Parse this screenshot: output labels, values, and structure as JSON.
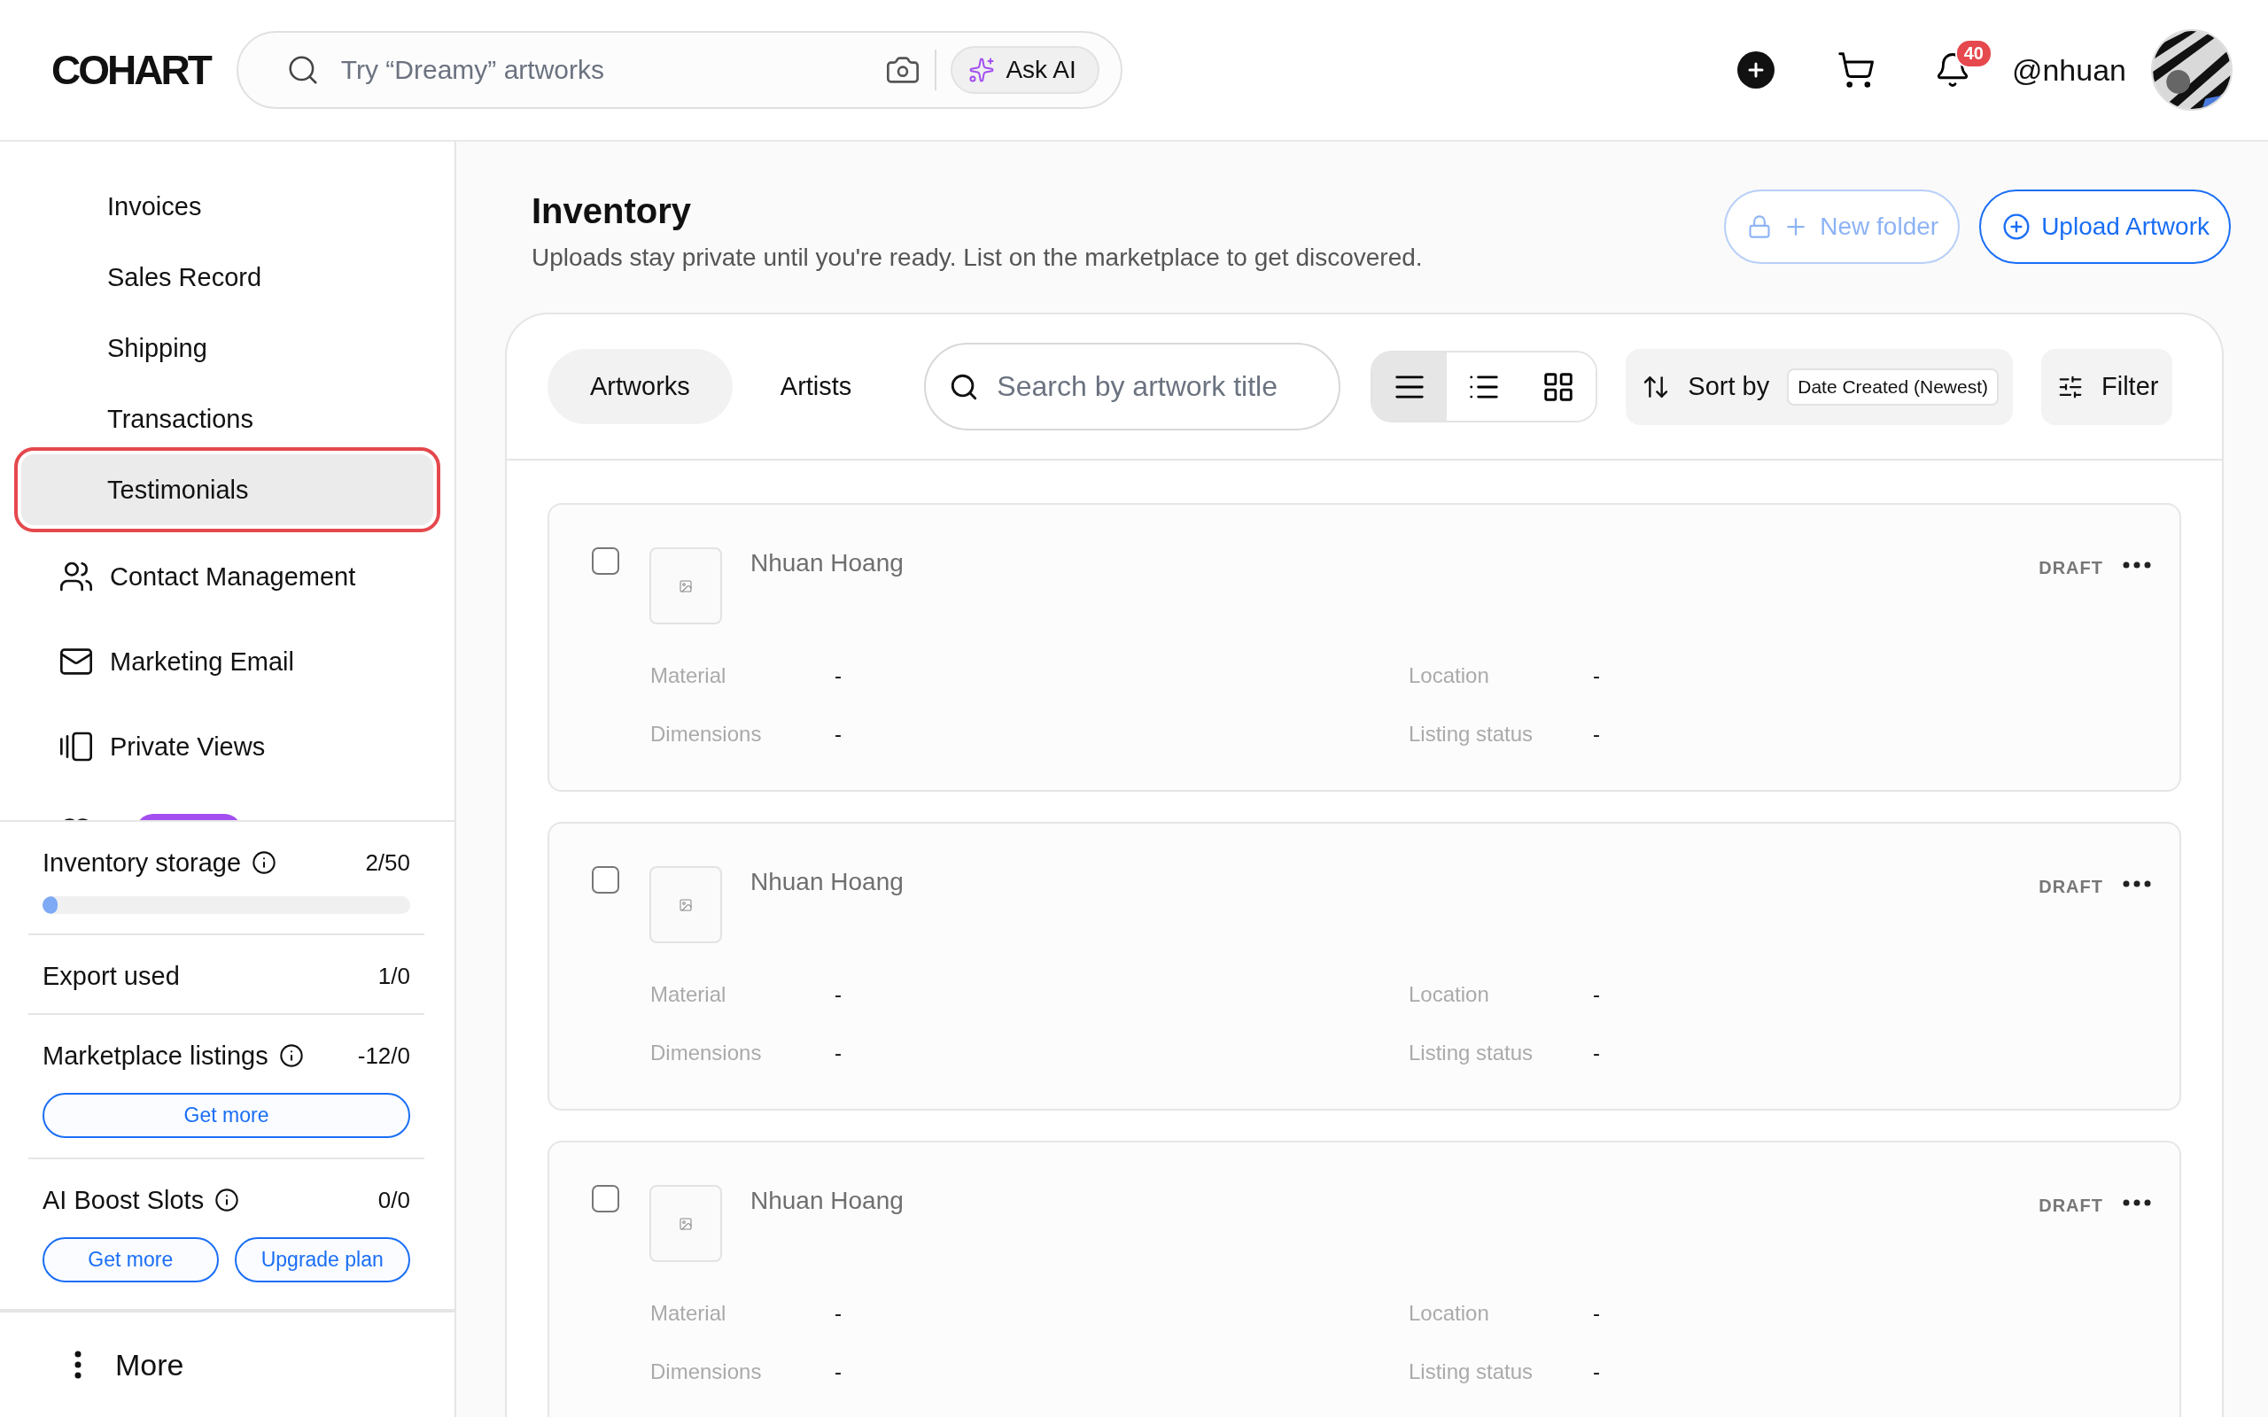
{
  "header": {
    "logo": "COHART",
    "search": {
      "placeholder": "Try “Dreamy” artworks"
    },
    "ask_ai": "Ask AI",
    "notifications": "40",
    "username": "@nhuan"
  },
  "sidebar": {
    "items": [
      {
        "label": "Invoices",
        "kind": "plain",
        "selected": false,
        "highlighted": false
      },
      {
        "label": "Sales Record",
        "kind": "plain",
        "selected": false,
        "highlighted": false
      },
      {
        "label": "Shipping",
        "kind": "plain",
        "selected": false,
        "highlighted": false
      },
      {
        "label": "Transactions",
        "kind": "plain",
        "selected": false,
        "highlighted": false
      },
      {
        "label": "Testimonials",
        "kind": "plain",
        "selected": true,
        "highlighted": true
      },
      {
        "label": "Contact Management",
        "kind": "contacts",
        "selected": false,
        "highlighted": false
      },
      {
        "label": "Marketing Email",
        "kind": "email",
        "selected": false,
        "highlighted": false
      },
      {
        "label": "Private Views",
        "kind": "views",
        "selected": false,
        "highlighted": false
      }
    ],
    "usage": [
      {
        "label": "Inventory storage",
        "info": true,
        "value": "2/50",
        "level": 0.04
      },
      {
        "label": "Export used",
        "info": false,
        "value": "1/0"
      },
      {
        "label": "Marketplace listings",
        "info": true,
        "value": "-12/0",
        "buttons": [
          "Get more"
        ]
      },
      {
        "label": "AI Boost Slots",
        "info": true,
        "value": "0/0",
        "buttons": [
          "Get more",
          "Upgrade plan"
        ]
      }
    ],
    "more": "More"
  },
  "main": {
    "title": "Inventory",
    "subtitle": "Uploads stay private until you're ready. List on the marketplace to get discovered.",
    "actions": [
      {
        "label": "New folder",
        "kind": "folder",
        "disabled": true
      },
      {
        "label": "Upload Artwork",
        "kind": "upload",
        "disabled": false
      }
    ],
    "tabs": [
      {
        "label": "Artworks",
        "selected": true
      },
      {
        "label": "Artists",
        "selected": false
      }
    ],
    "search": {
      "placeholder": "Search by artwork title"
    },
    "views": [
      {
        "kind": "rows",
        "selected": true
      },
      {
        "kind": "list",
        "selected": false
      },
      {
        "kind": "grid",
        "selected": false
      }
    ],
    "sort": {
      "label": "Sort by",
      "value": "Date Created (Newest)"
    },
    "filter": "Filter",
    "artworks": [
      {
        "name": "Nhuan Hoang",
        "status": "DRAFT",
        "checked": false,
        "fields": [
          {
            "label": "Material",
            "value": "-"
          },
          {
            "label": "Location",
            "value": "-"
          },
          {
            "label": "Dimensions",
            "value": "-"
          },
          {
            "label": "Listing status",
            "value": "-"
          }
        ]
      },
      {
        "name": "Nhuan Hoang",
        "status": "DRAFT",
        "checked": false,
        "fields": [
          {
            "label": "Material",
            "value": "-"
          },
          {
            "label": "Location",
            "value": "-"
          },
          {
            "label": "Dimensions",
            "value": "-"
          },
          {
            "label": "Listing status",
            "value": "-"
          }
        ]
      },
      {
        "name": "Nhuan Hoang",
        "status": "DRAFT",
        "checked": false,
        "fields": [
          {
            "label": "Material",
            "value": "-"
          },
          {
            "label": "Location",
            "value": "-"
          },
          {
            "label": "Dimensions",
            "value": "-"
          },
          {
            "label": "Listing status",
            "value": "-"
          }
        ]
      }
    ]
  }
}
